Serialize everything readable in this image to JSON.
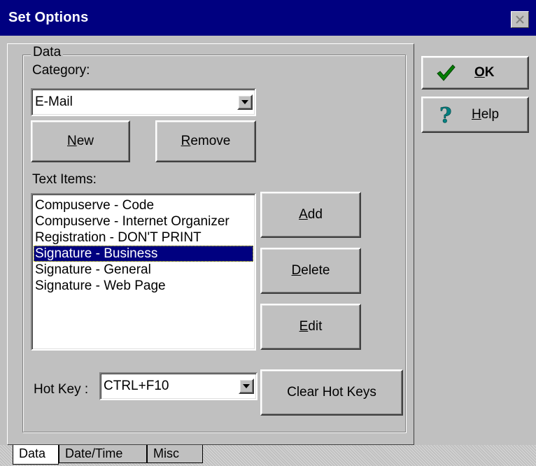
{
  "window": {
    "title": "Set Options"
  },
  "data_group": {
    "label": "Data"
  },
  "category": {
    "label": "Category:",
    "value": "E-Mail"
  },
  "buttons": {
    "new": {
      "mnemonic": "N",
      "rest": "ew"
    },
    "remove": {
      "mnemonic": "R",
      "rest": "emove"
    },
    "add": {
      "mnemonic": "A",
      "rest": "dd"
    },
    "delete": {
      "mnemonic": "D",
      "rest": "elete"
    },
    "edit": {
      "mnemonic": "E",
      "rest": "dit"
    },
    "clear_hot_keys": "Clear Hot Keys",
    "ok": {
      "mnemonic": "O",
      "rest": "K"
    },
    "help": {
      "mnemonic": "H",
      "rest": "elp"
    }
  },
  "text_items": {
    "label": "Text Items:",
    "items": [
      "Compuserve - Code",
      "Compuserve - Internet Organizer",
      "Registration - DON'T PRINT",
      "Signature - Business",
      "Signature - General",
      "Signature - Web Page"
    ],
    "selected_index": 3
  },
  "hot_key": {
    "label": "Hot Key :",
    "value": "CTRL+F10"
  },
  "tabs": [
    "Data",
    "Date/Time",
    "Misc"
  ],
  "colors": {
    "titlebar": "#000080",
    "face": "#c0c0c0",
    "check": "#008000",
    "help_icon": "#008080"
  },
  "icons": {
    "ok": "checkmark-icon",
    "help": "question-mark-icon",
    "close": "close-icon",
    "dropdown": "dropdown-arrow-icon"
  }
}
